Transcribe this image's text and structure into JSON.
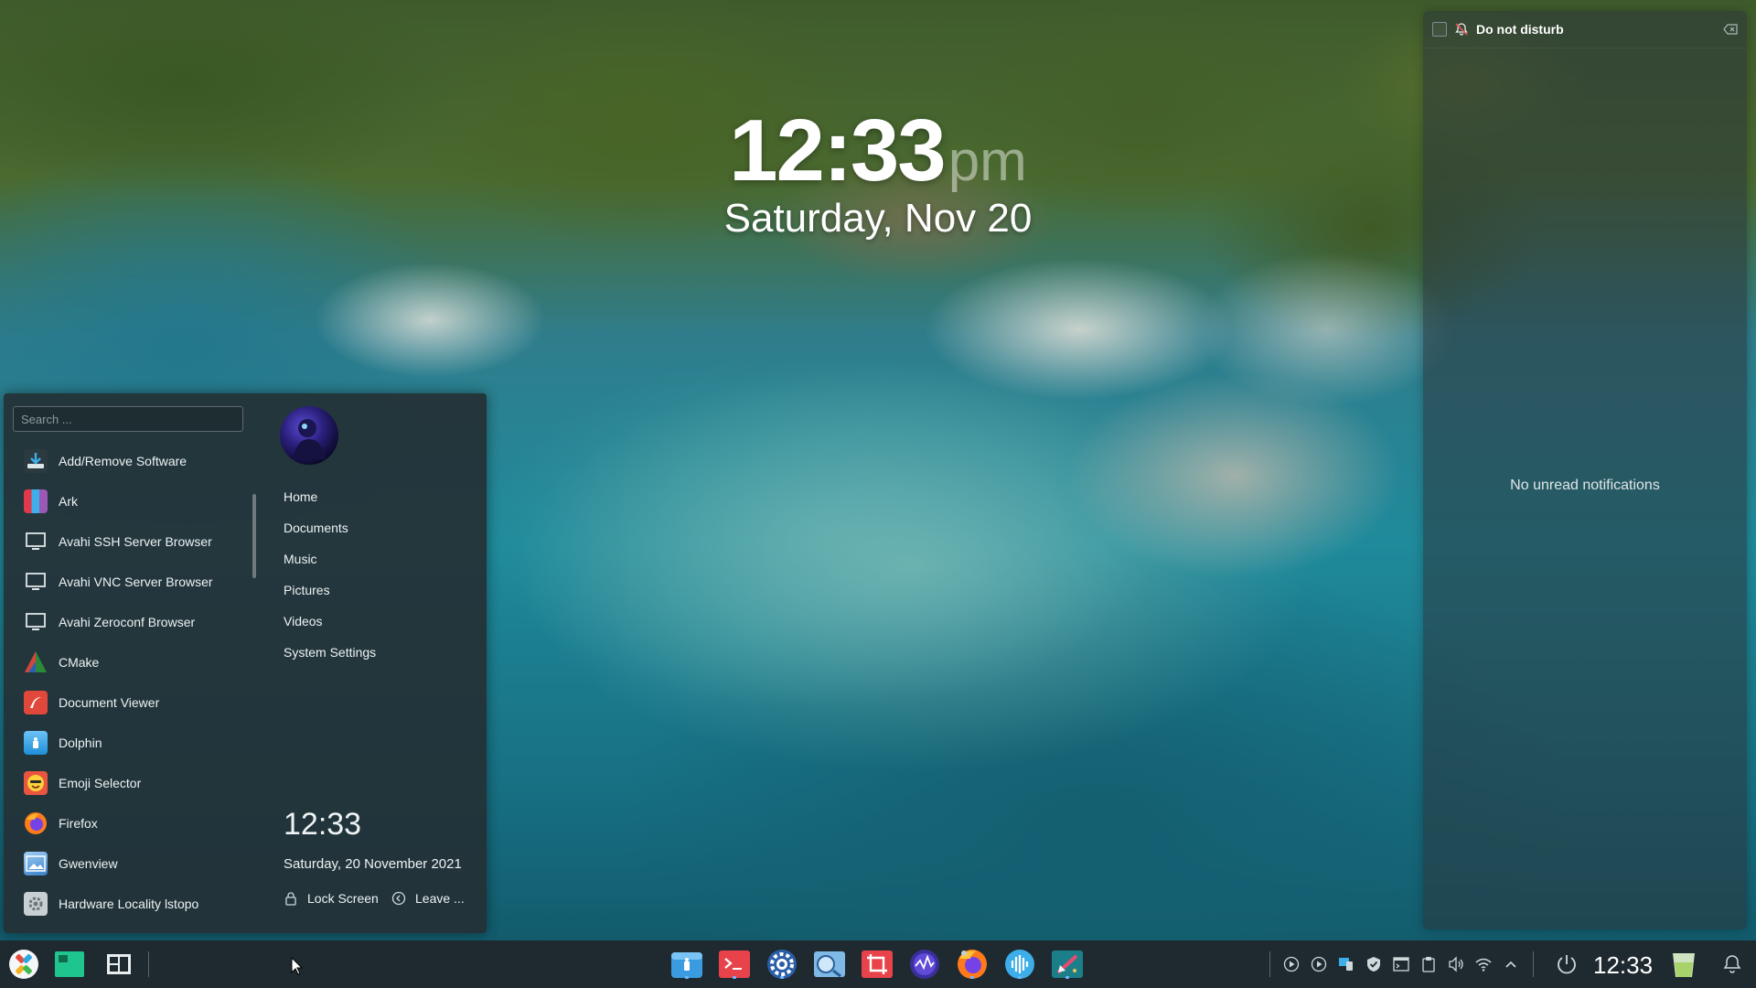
{
  "desktop_clock": {
    "time": "12:33",
    "ampm": "pm",
    "date": "Saturday, Nov 20"
  },
  "notifications": {
    "dnd_label": "Do not disturb",
    "empty_text": "No unread notifications"
  },
  "launcher": {
    "search_placeholder": "Search ...",
    "apps": [
      {
        "label": "Add/Remove Software",
        "icon": "download-icon"
      },
      {
        "label": "Ark",
        "icon": "ark-icon"
      },
      {
        "label": "Avahi SSH Server Browser",
        "icon": "monitor-icon"
      },
      {
        "label": "Avahi VNC Server Browser",
        "icon": "monitor-icon"
      },
      {
        "label": "Avahi Zeroconf Browser",
        "icon": "monitor-icon"
      },
      {
        "label": "CMake",
        "icon": "cmake-icon"
      },
      {
        "label": "Document Viewer",
        "icon": "document-viewer-icon"
      },
      {
        "label": "Dolphin",
        "icon": "dolphin-icon"
      },
      {
        "label": "Emoji Selector",
        "icon": "emoji-icon"
      },
      {
        "label": "Firefox",
        "icon": "firefox-icon"
      },
      {
        "label": "Gwenview",
        "icon": "gwenview-icon"
      },
      {
        "label": "Hardware Locality lstopo",
        "icon": "gear-icon"
      }
    ],
    "places": [
      "Home",
      "Documents",
      "Music",
      "Pictures",
      "Videos",
      "System Settings"
    ],
    "time": "12:33",
    "date": "Saturday, 20 November 2021",
    "lock_label": "Lock Screen",
    "leave_label": "Leave ..."
  },
  "taskbar": {
    "clock": "12:33",
    "accent": "#3daee9",
    "panel_color": "#1f2a30"
  }
}
